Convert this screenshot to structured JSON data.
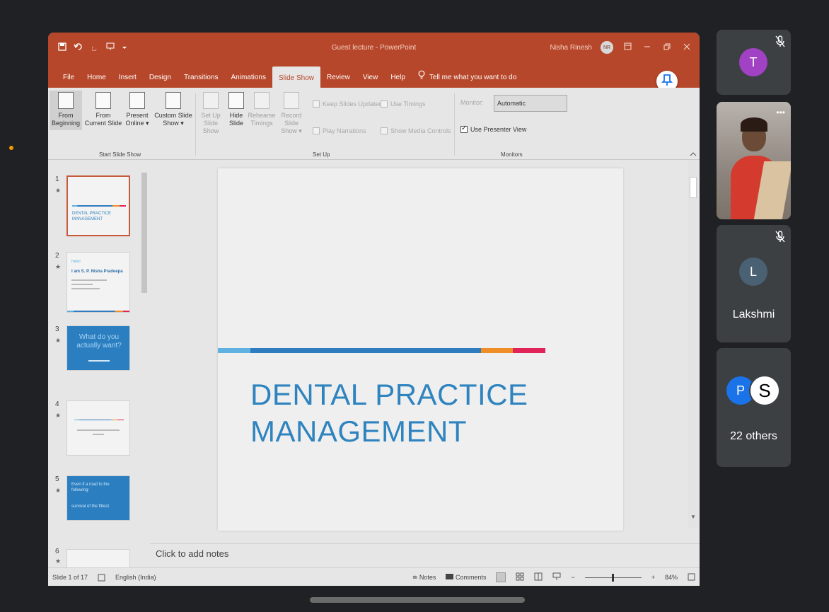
{
  "powerpoint": {
    "doc_title": "Guest lecture - PowerPoint",
    "user_name": "Nisha Rinesh",
    "user_initials": "NR",
    "tabs": [
      "File",
      "Home",
      "Insert",
      "Design",
      "Transitions",
      "Animations",
      "Slide Show",
      "Review",
      "View",
      "Help"
    ],
    "active_tab": "Slide Show",
    "tell_me": "Tell me what you want to do",
    "ribbon": {
      "start_group_label": "Start Slide Show",
      "from_beginning": [
        "From",
        "Beginning"
      ],
      "from_current": [
        "From",
        "Current Slide"
      ],
      "present_online": [
        "Present",
        "Online ▾"
      ],
      "custom_show": [
        "Custom Slide",
        "Show ▾"
      ],
      "setup_group_label": "Set Up",
      "setup_show": [
        "Set Up",
        "Slide Show"
      ],
      "hide_slide": [
        "Hide",
        "Slide"
      ],
      "rehearse": [
        "Rehearse",
        "Timings"
      ],
      "record": [
        "Record Slide",
        "Show ▾"
      ],
      "keep_updated": "Keep Slides Updated",
      "use_timings": "Use Timings",
      "play_narrations": "Play Narrations",
      "show_media": "Show Media Controls",
      "monitors_group_label": "Monitors",
      "monitor_label": "Monitor:",
      "monitor_value": "Automatic",
      "presenter_view": "Use Presenter View"
    },
    "thumbnails": [
      {
        "num": "1",
        "text": "DENTAL PRACTICE MANAGEMENT"
      },
      {
        "num": "2",
        "title": "I am S. P. Nisha Pradeepa",
        "hello": "Hello!"
      },
      {
        "num": "3",
        "text": "What do you actually want?"
      },
      {
        "num": "4"
      },
      {
        "num": "5",
        "text": "Even if a road to the following:",
        "sub": "survival of the fittest"
      },
      {
        "num": "6"
      }
    ],
    "slide_title_line1": "DENTAL PRACTICE",
    "slide_title_line2": "MANAGEMENT",
    "notes_placeholder": "Click to add notes",
    "status": {
      "slide_info": "Slide 1 of 17",
      "language": "English (India)",
      "notes": "Notes",
      "comments": "Comments",
      "zoom": "84%"
    },
    "colors": {
      "title_bar": "#b7472a",
      "slide_text": "#2f84bf",
      "line_light_blue": "#5eb1e0",
      "line_blue": "#2f7bbf",
      "line_orange": "#ef8e26",
      "line_red": "#e0245a"
    }
  },
  "meeting": {
    "participants": [
      {
        "initial": "T",
        "color": "#a142c4",
        "muted": true
      },
      {
        "type": "video",
        "muted": false
      },
      {
        "initial": "L",
        "name": "Lakshmi",
        "color": "#4a6174",
        "muted": true
      },
      {
        "initials": [
          "P",
          "S"
        ],
        "label": "22 others"
      }
    ]
  }
}
